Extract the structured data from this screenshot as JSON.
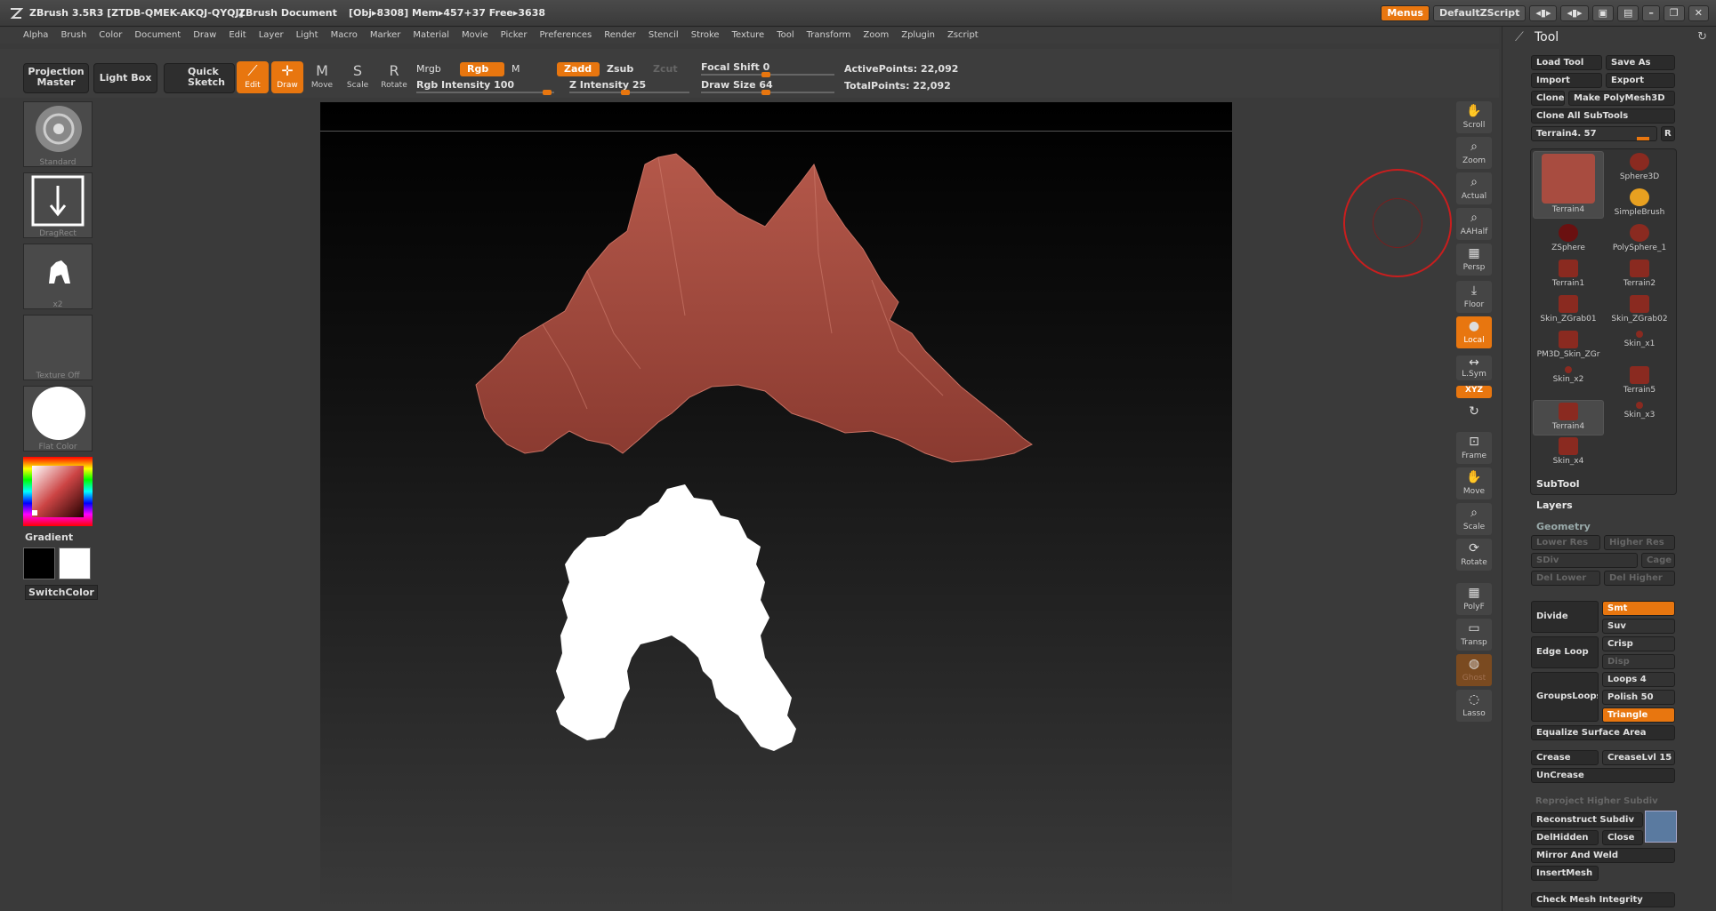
{
  "titlebar": {
    "app": "ZBrush 3.5R3  [ZTDB-QMEK-AKQJ-QYQJ]",
    "doc": "ZBrush Document",
    "mem": "[Obj▸8308]  Mem▸457+37  Free▸3638",
    "menus_btn": "Menus",
    "script_btn": "DefaultZScript"
  },
  "menu": [
    "Alpha",
    "Brush",
    "Color",
    "Document",
    "Draw",
    "Edit",
    "Layer",
    "Light",
    "Macro",
    "Marker",
    "Material",
    "Movie",
    "Picker",
    "Preferences",
    "Render",
    "Stencil",
    "Stroke",
    "Texture",
    "Tool",
    "Transform",
    "Zoom",
    "Zplugin",
    "Zscript"
  ],
  "toolbar": {
    "projection_master": "Projection Master",
    "light_box": "Light Box",
    "quick_sketch": "Quick Sketch",
    "edit": "Edit",
    "draw": "Draw",
    "move": "Move",
    "scale": "Scale",
    "rotate": "Rotate",
    "mrgb": "Mrgb",
    "rgb": "Rgb",
    "m": "M",
    "zadd": "Zadd",
    "zsub": "Zsub",
    "zcut": "Zcut",
    "rgb_intensity": "Rgb Intensity 100",
    "z_intensity": "Z Intensity 25",
    "focal_shift": "Focal Shift 0",
    "draw_size": "Draw Size 64",
    "active_points": "ActivePoints: 22,092",
    "total_points": "TotalPoints: 22,092"
  },
  "left": {
    "standard": "Standard",
    "dragrect": "DragRect",
    "alpha_x2": "x2",
    "texture_off": "Texture Off",
    "flat_color": "Flat Color",
    "gradient": "Gradient",
    "switchcolor": "SwitchColor"
  },
  "right_strip": [
    "Scroll",
    "Zoom",
    "Actual",
    "AAHalf",
    "Persp",
    "Floor",
    "Local",
    "L.Sym",
    "XYZ",
    "",
    "Frame",
    "Move",
    "Scale",
    "Rotate",
    "PolyF",
    "Transp",
    "Ghost",
    "Lasso"
  ],
  "tool": {
    "title": "Tool",
    "load_tool": "Load Tool",
    "save_as": "Save As",
    "import": "Import",
    "export": "Export",
    "clone": "Clone",
    "make_polymesh": "Make PolyMesh3D",
    "clone_all": "Clone All SubTools",
    "current": "Terrain4. 57",
    "r": "R",
    "items": [
      "Terrain4",
      "Sphere3D",
      "SimpleBrush",
      "ZSphere",
      "PolySphere_1",
      "Terrain1",
      "Terrain2",
      "Skin_ZGrab01",
      "Skin_ZGrab02",
      "PM3D_Skin_ZGr",
      "Skin_x1",
      "Skin_x2",
      "Terrain5",
      "Terrain4",
      "Skin_x3",
      "Skin_x4"
    ],
    "subtool": "SubTool",
    "layers": "Layers",
    "geometry": "Geometry",
    "lower_res": "Lower Res",
    "higher_res": "Higher Res",
    "sdiv": "SDiv",
    "cage": "Cage",
    "del_lower": "Del Lower",
    "del_higher": "Del Higher",
    "divide": "Divide",
    "smt": "Smt",
    "suv": "Suv",
    "edge_loop": "Edge Loop",
    "crisp": "Crisp",
    "disp": "Disp",
    "loops": "Loops 4",
    "groupsloops": "GroupsLoops",
    "polish": "Polish 50",
    "triangle": "Triangle",
    "equalize": "Equalize Surface Area",
    "crease": "Crease",
    "crease_lvl": "CreaseLvl 15",
    "uncrease": "UnCrease",
    "reproject": "Reproject Higher Subdiv",
    "reconstruct": "Reconstruct Subdiv",
    "delhidden": "DelHidden",
    "close": "Close",
    "mirror_weld": "Mirror And Weld",
    "insertmesh": "InsertMesh",
    "check_integrity": "Check Mesh Integrity"
  },
  "colors": {
    "accent": "#e8760f",
    "terrain": "#a0483c",
    "brush_ring": "#c81e1e"
  }
}
